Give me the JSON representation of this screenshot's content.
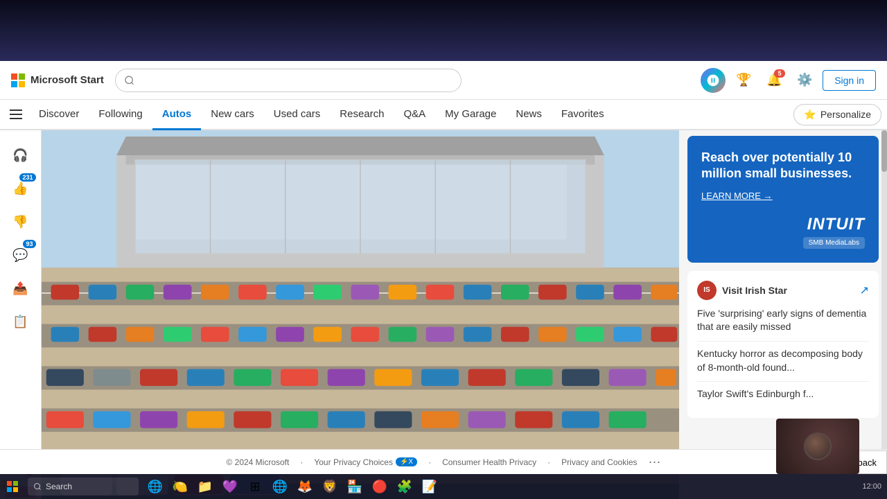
{
  "browser": {
    "chrome_visible": true
  },
  "header": {
    "logo_text": "Microsoft Start",
    "sign_in_label": "Sign in",
    "notifications_badge": "5"
  },
  "nav": {
    "active_item": "Autos",
    "items": [
      {
        "id": "discover",
        "label": "Discover"
      },
      {
        "id": "following",
        "label": "Following"
      },
      {
        "id": "autos",
        "label": "Autos"
      },
      {
        "id": "new-cars",
        "label": "New cars"
      },
      {
        "id": "used-cars",
        "label": "Used cars"
      },
      {
        "id": "research",
        "label": "Research"
      },
      {
        "id": "qa",
        "label": "Q&A"
      },
      {
        "id": "my-garage",
        "label": "My Garage"
      },
      {
        "id": "news",
        "label": "News"
      },
      {
        "id": "favorites",
        "label": "Favorites"
      }
    ],
    "personalize_label": "Personalize"
  },
  "sidebar_left": {
    "like_count": "231",
    "comment_count": "93"
  },
  "ad": {
    "title": "Reach over potentially 10 million small businesses.",
    "learn_more": "LEARN MORE →",
    "brand": "INTUIT",
    "sub_brand": "SMB MediaLabs"
  },
  "news_widget": {
    "source_name": "Visit Irish Star",
    "source_abbr": "IS",
    "headline_1": "Five 'surprising' early signs of dementia that are easily missed",
    "headline_2": "Kentucky horror as decomposing body of 8-month-old found...",
    "headline_3": "Taylor Swift's Edinburgh f..."
  },
  "footer": {
    "copyright": "© 2024 Microsoft",
    "privacy_choices": "Your Privacy Choices",
    "consumer_health": "Consumer Health Privacy",
    "privacy_cookies": "Privacy and Cookies"
  },
  "feedback": {
    "label": "Feedback"
  },
  "taskbar": {
    "search_placeholder": "Search"
  }
}
